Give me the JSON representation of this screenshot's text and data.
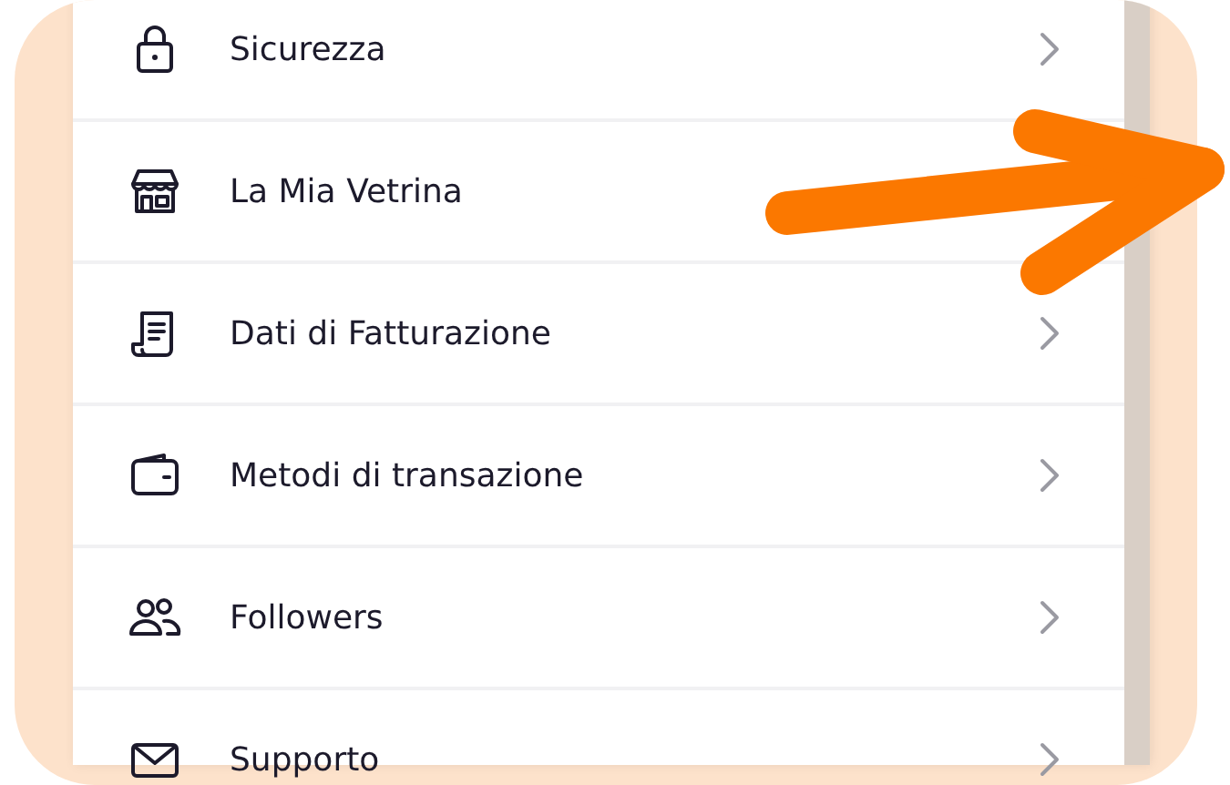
{
  "menu": {
    "items": [
      {
        "label": "Sicurezza"
      },
      {
        "label": "La Mia Vetrina"
      },
      {
        "label": "Dati di Fatturazione"
      },
      {
        "label": "Metodi di transazione"
      },
      {
        "label": "Followers"
      },
      {
        "label": "Supporto"
      }
    ]
  }
}
